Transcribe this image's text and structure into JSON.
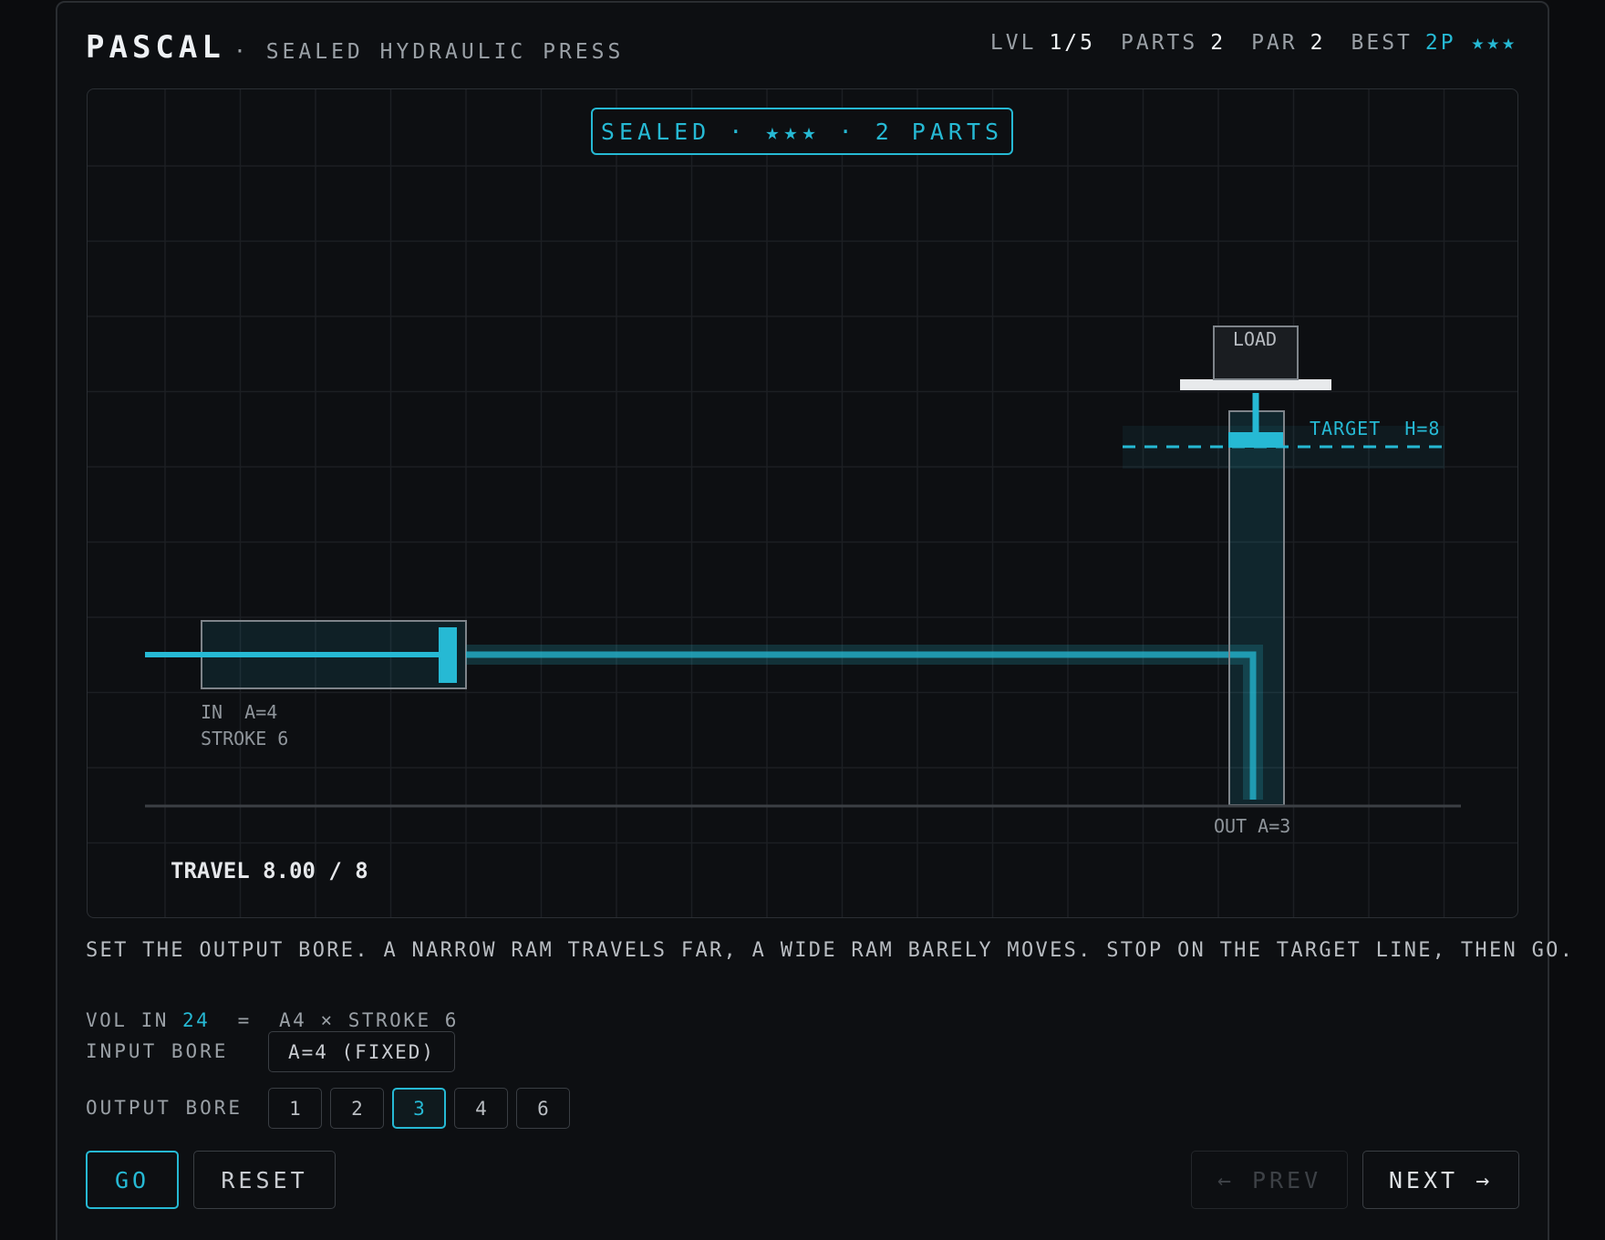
{
  "header": {
    "brand": "PASCAL",
    "subtitle": "· SEALED HYDRAULIC PRESS",
    "stats": [
      {
        "key": "LVL",
        "value": "1/5"
      },
      {
        "key": "PARTS",
        "value": "2"
      },
      {
        "key": "PAR",
        "value": "2"
      },
      {
        "key": "BEST",
        "value": "2P ★★★"
      }
    ]
  },
  "board": {
    "status_badge": "SEALED · ★★★ · 2 PARTS",
    "input_label_line1": "IN  A=4",
    "input_label_line2": "STROKE 6",
    "output_label": "OUT A=3",
    "load_label": "LOAD",
    "target_label": "TARGET  H=8",
    "travel_readout": "TRAVEL 8.00 / 8",
    "travel_value": 8.0,
    "target_height": 8
  },
  "instructions": "SET THE OUTPUT BORE. A NARROW RAM TRAVELS FAR, A WIDE RAM BARELY MOVES. STOP ON THE TARGET LINE, THEN GO.",
  "controls": {
    "formula_prefix": "VOL IN ",
    "formula_value": "24",
    "formula_suffix": "  =  A4 × STROKE 6",
    "input_bore_label": "INPUT BORE",
    "input_bore_value": "A=4 (FIXED)",
    "output_bore_label": "OUTPUT BORE",
    "output_bore_options": [
      "1",
      "2",
      "3",
      "4",
      "6"
    ],
    "output_bore_selected": "3"
  },
  "buttons": {
    "go": "GO",
    "reset": "RESET",
    "prev": "← PREV",
    "next": "NEXT →"
  },
  "colors": {
    "accent": "#26b9d4",
    "background": "#0d0f12",
    "grid": "#1c1f23"
  }
}
